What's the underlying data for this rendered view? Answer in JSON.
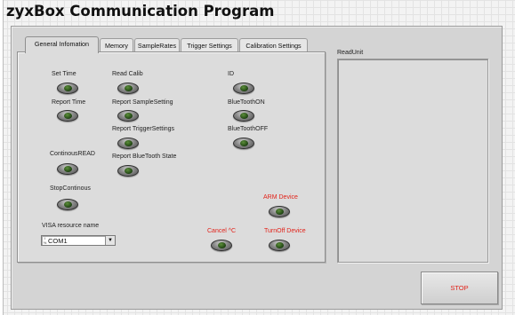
{
  "window": {
    "title": "zyxBox Communication Program"
  },
  "tabs": [
    {
      "label": "General Infomation",
      "active": true
    },
    {
      "label": "Memory",
      "active": false
    },
    {
      "label": "SampleRates",
      "active": false
    },
    {
      "label": "Trigger Settings",
      "active": false
    },
    {
      "label": "Calibration Settings",
      "active": false
    }
  ],
  "general": {
    "set_time_label": "Set Time",
    "report_time_label": "Report Time",
    "continuous_read_label": "ContinousREAD",
    "stop_continuous_label": "StopContinous",
    "read_calib_label": "Read Calib",
    "report_sample_setting_label": "Report SampleSetting",
    "report_trigger_settings_label": "Report TriggerSettings",
    "report_bluetooth_state_label": "Report BlueTooth State",
    "id_label": "ID",
    "bluetooth_on_label": "BlueToothON",
    "bluetooth_off_label": "BlueToothOFF",
    "arm_device_label": "ARM Device",
    "cancel_label": "Cancel ^C",
    "turnoff_device_label": "TurnOff Device",
    "visa_resource_label": "VISA resource name",
    "visa_resource_value": "COM1"
  },
  "read_unit": {
    "label": "ReadUnit"
  },
  "stop_button": {
    "label": "STOP"
  },
  "colors": {
    "alert_label": "#e2231a",
    "panel_background": "#d4d4d4",
    "led_green": "#2f5a1c"
  }
}
